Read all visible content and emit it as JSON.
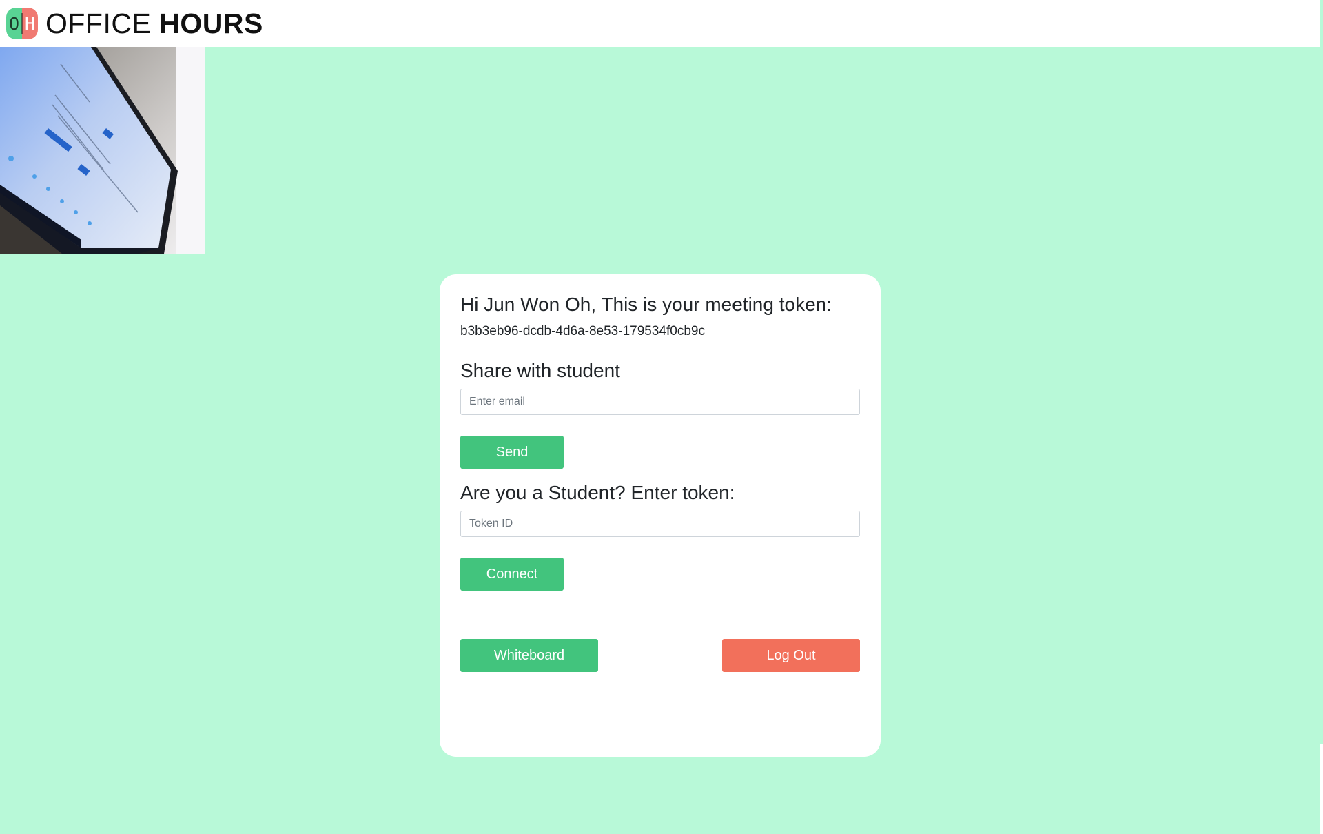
{
  "header": {
    "logo_left": "O",
    "logo_right": "H",
    "brand_light": "OFFICE",
    "brand_bold": "HOURS"
  },
  "camera": {
    "label": "webcam preview"
  },
  "card": {
    "greeting": "Hi Jun Won Oh, This is your meeting token:",
    "token": "b3b3eb96-dcdb-4d6a-8e53-179534f0cb9c",
    "share_label": "Share with student",
    "email_placeholder": "Enter email",
    "send_label": "Send",
    "student_label": "Are you a Student? Enter token:",
    "token_placeholder": "Token ID",
    "connect_label": "Connect",
    "whiteboard_label": "Whiteboard",
    "logout_label": "Log Out"
  },
  "colors": {
    "background": "#b8f9d8",
    "primary_button": "#42c47d",
    "danger_button": "#f2705b",
    "logo_green": "#59d394",
    "logo_red": "#f07a72"
  }
}
